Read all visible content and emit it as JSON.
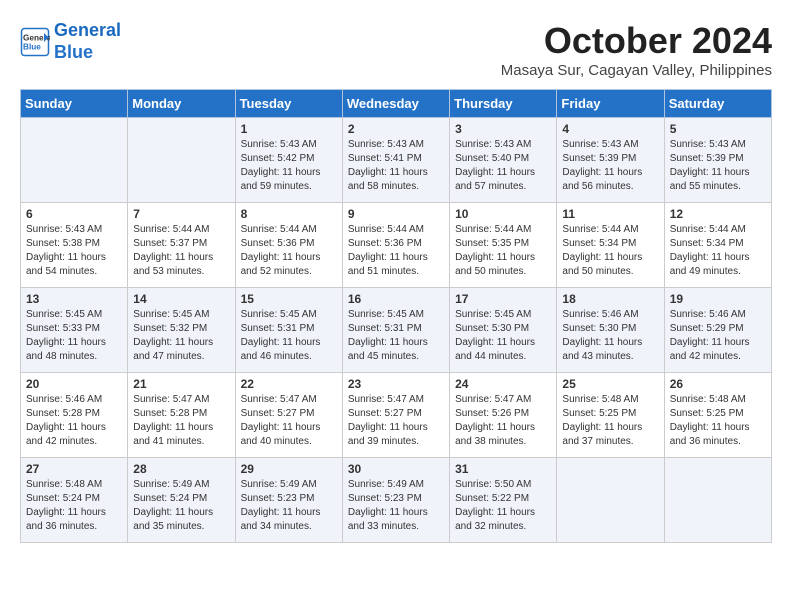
{
  "header": {
    "logo_line1": "General",
    "logo_line2": "Blue",
    "month_title": "October 2024",
    "location": "Masaya Sur, Cagayan Valley, Philippines"
  },
  "columns": [
    "Sunday",
    "Monday",
    "Tuesday",
    "Wednesday",
    "Thursday",
    "Friday",
    "Saturday"
  ],
  "weeks": [
    [
      {
        "day": "",
        "info": ""
      },
      {
        "day": "",
        "info": ""
      },
      {
        "day": "1",
        "info": "Sunrise: 5:43 AM\nSunset: 5:42 PM\nDaylight: 11 hours and 59 minutes."
      },
      {
        "day": "2",
        "info": "Sunrise: 5:43 AM\nSunset: 5:41 PM\nDaylight: 11 hours and 58 minutes."
      },
      {
        "day": "3",
        "info": "Sunrise: 5:43 AM\nSunset: 5:40 PM\nDaylight: 11 hours and 57 minutes."
      },
      {
        "day": "4",
        "info": "Sunrise: 5:43 AM\nSunset: 5:39 PM\nDaylight: 11 hours and 56 minutes."
      },
      {
        "day": "5",
        "info": "Sunrise: 5:43 AM\nSunset: 5:39 PM\nDaylight: 11 hours and 55 minutes."
      }
    ],
    [
      {
        "day": "6",
        "info": "Sunrise: 5:43 AM\nSunset: 5:38 PM\nDaylight: 11 hours and 54 minutes."
      },
      {
        "day": "7",
        "info": "Sunrise: 5:44 AM\nSunset: 5:37 PM\nDaylight: 11 hours and 53 minutes."
      },
      {
        "day": "8",
        "info": "Sunrise: 5:44 AM\nSunset: 5:36 PM\nDaylight: 11 hours and 52 minutes."
      },
      {
        "day": "9",
        "info": "Sunrise: 5:44 AM\nSunset: 5:36 PM\nDaylight: 11 hours and 51 minutes."
      },
      {
        "day": "10",
        "info": "Sunrise: 5:44 AM\nSunset: 5:35 PM\nDaylight: 11 hours and 50 minutes."
      },
      {
        "day": "11",
        "info": "Sunrise: 5:44 AM\nSunset: 5:34 PM\nDaylight: 11 hours and 50 minutes."
      },
      {
        "day": "12",
        "info": "Sunrise: 5:44 AM\nSunset: 5:34 PM\nDaylight: 11 hours and 49 minutes."
      }
    ],
    [
      {
        "day": "13",
        "info": "Sunrise: 5:45 AM\nSunset: 5:33 PM\nDaylight: 11 hours and 48 minutes."
      },
      {
        "day": "14",
        "info": "Sunrise: 5:45 AM\nSunset: 5:32 PM\nDaylight: 11 hours and 47 minutes."
      },
      {
        "day": "15",
        "info": "Sunrise: 5:45 AM\nSunset: 5:31 PM\nDaylight: 11 hours and 46 minutes."
      },
      {
        "day": "16",
        "info": "Sunrise: 5:45 AM\nSunset: 5:31 PM\nDaylight: 11 hours and 45 minutes."
      },
      {
        "day": "17",
        "info": "Sunrise: 5:45 AM\nSunset: 5:30 PM\nDaylight: 11 hours and 44 minutes."
      },
      {
        "day": "18",
        "info": "Sunrise: 5:46 AM\nSunset: 5:30 PM\nDaylight: 11 hours and 43 minutes."
      },
      {
        "day": "19",
        "info": "Sunrise: 5:46 AM\nSunset: 5:29 PM\nDaylight: 11 hours and 42 minutes."
      }
    ],
    [
      {
        "day": "20",
        "info": "Sunrise: 5:46 AM\nSunset: 5:28 PM\nDaylight: 11 hours and 42 minutes."
      },
      {
        "day": "21",
        "info": "Sunrise: 5:47 AM\nSunset: 5:28 PM\nDaylight: 11 hours and 41 minutes."
      },
      {
        "day": "22",
        "info": "Sunrise: 5:47 AM\nSunset: 5:27 PM\nDaylight: 11 hours and 40 minutes."
      },
      {
        "day": "23",
        "info": "Sunrise: 5:47 AM\nSunset: 5:27 PM\nDaylight: 11 hours and 39 minutes."
      },
      {
        "day": "24",
        "info": "Sunrise: 5:47 AM\nSunset: 5:26 PM\nDaylight: 11 hours and 38 minutes."
      },
      {
        "day": "25",
        "info": "Sunrise: 5:48 AM\nSunset: 5:25 PM\nDaylight: 11 hours and 37 minutes."
      },
      {
        "day": "26",
        "info": "Sunrise: 5:48 AM\nSunset: 5:25 PM\nDaylight: 11 hours and 36 minutes."
      }
    ],
    [
      {
        "day": "27",
        "info": "Sunrise: 5:48 AM\nSunset: 5:24 PM\nDaylight: 11 hours and 36 minutes."
      },
      {
        "day": "28",
        "info": "Sunrise: 5:49 AM\nSunset: 5:24 PM\nDaylight: 11 hours and 35 minutes."
      },
      {
        "day": "29",
        "info": "Sunrise: 5:49 AM\nSunset: 5:23 PM\nDaylight: 11 hours and 34 minutes."
      },
      {
        "day": "30",
        "info": "Sunrise: 5:49 AM\nSunset: 5:23 PM\nDaylight: 11 hours and 33 minutes."
      },
      {
        "day": "31",
        "info": "Sunrise: 5:50 AM\nSunset: 5:22 PM\nDaylight: 11 hours and 32 minutes."
      },
      {
        "day": "",
        "info": ""
      },
      {
        "day": "",
        "info": ""
      }
    ]
  ]
}
